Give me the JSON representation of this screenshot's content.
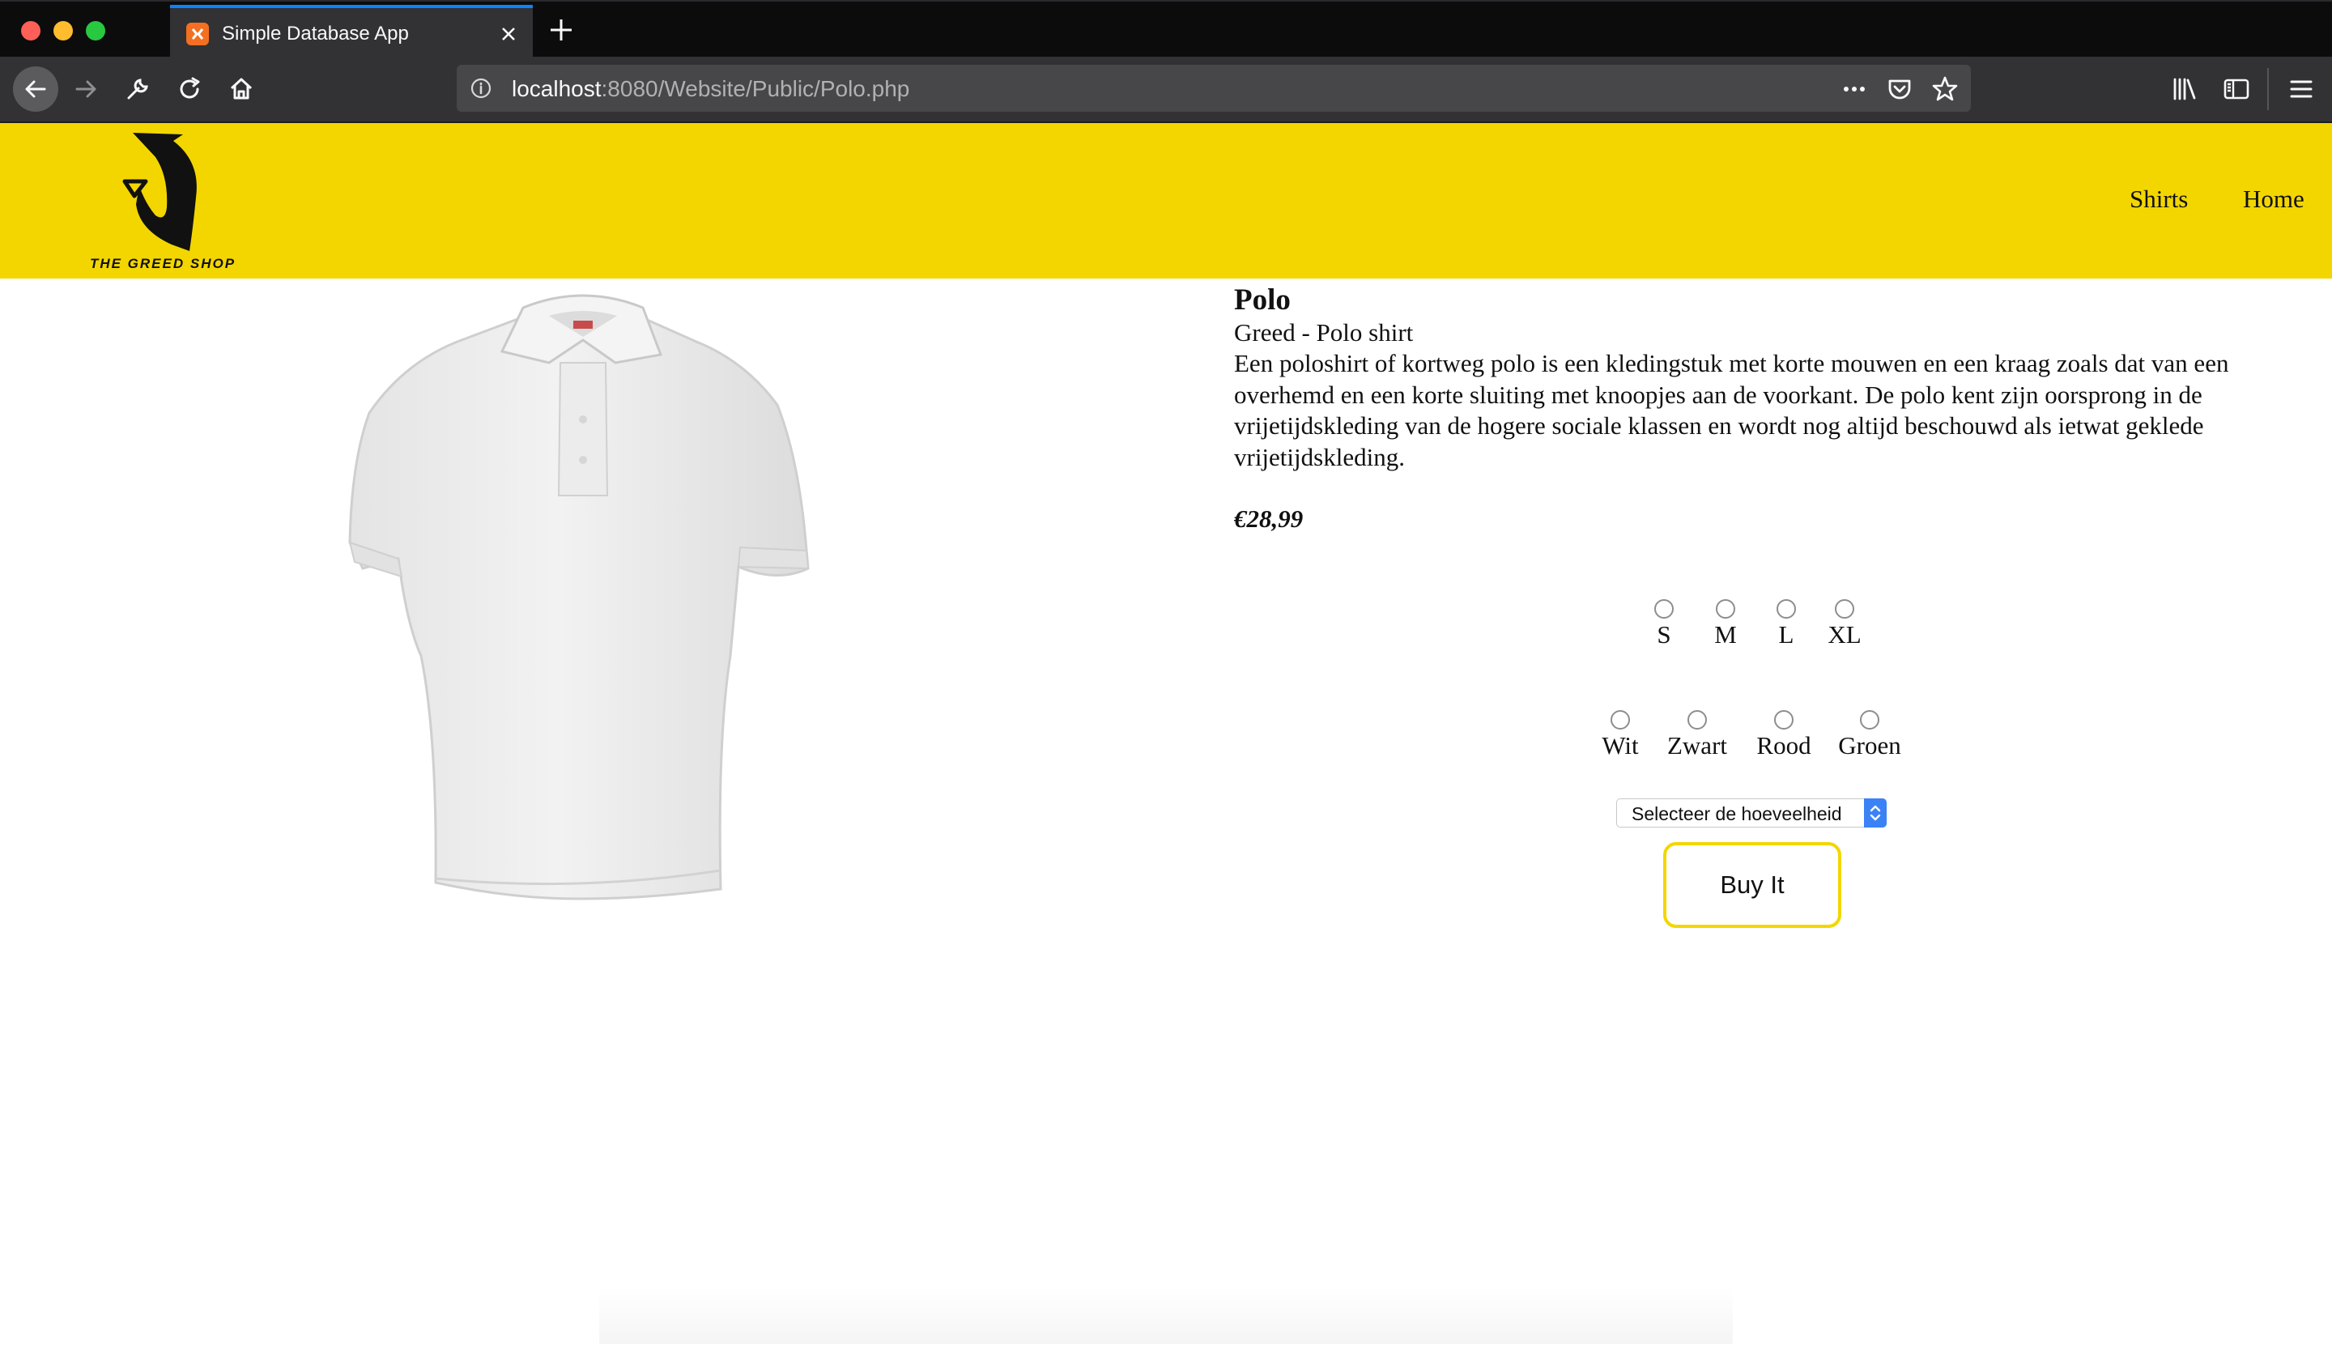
{
  "browser": {
    "tab_title": "Simple Database App",
    "url_host": "localhost",
    "url_rest": ":8080/Website/Public/Polo.php"
  },
  "header": {
    "logo_text": "THE GREED SHOP",
    "nav": [
      {
        "label": "Shirts"
      },
      {
        "label": "Home"
      }
    ],
    "background_color": "#f3d600"
  },
  "product": {
    "title": "Polo",
    "subtitle": "Greed - Polo shirt",
    "description": "Een poloshirt of kortweg polo is een kledingstuk met korte mouwen en een kraag zoals dat van een overhemd en een korte sluiting met knoopjes aan de voorkant. De polo kent zijn oorsprong in de vrijetijdskleding van de hogere sociale klassen en wordt nog altijd beschouwd als ietwat geklede vrijetijdskleding.",
    "price": "€28,99",
    "sizes": [
      {
        "label": "S"
      },
      {
        "label": "M"
      },
      {
        "label": "L"
      },
      {
        "label": "XL"
      }
    ],
    "colors": [
      {
        "label": "Wit"
      },
      {
        "label": "Zwart"
      },
      {
        "label": "Rood"
      },
      {
        "label": "Groen"
      }
    ],
    "quantity_select": "Selecteer de hoeveelheid",
    "buy_label": "Buy It"
  }
}
